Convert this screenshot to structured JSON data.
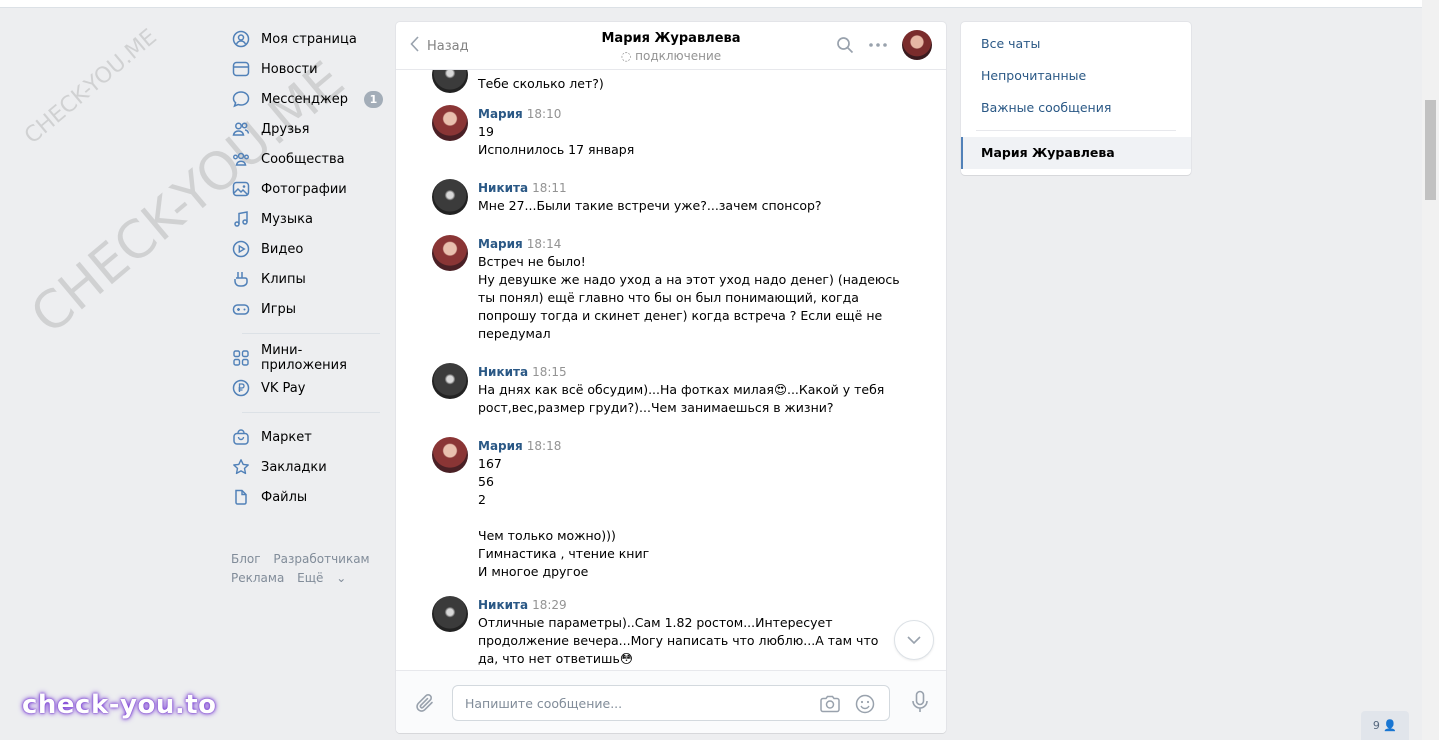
{
  "watermark": {
    "small": "CHECK-YOU.ME",
    "large": "CHECK-YOU.ME",
    "brand": "check-you.to"
  },
  "nav": {
    "items": [
      {
        "label": "Моя страница",
        "icon": "user-circle-icon"
      },
      {
        "label": "Новости",
        "icon": "news-icon"
      },
      {
        "label": "Мессенджер",
        "icon": "message-icon",
        "badge": "1"
      },
      {
        "label": "Друзья",
        "icon": "friends-icon"
      },
      {
        "label": "Сообщества",
        "icon": "communities-icon"
      },
      {
        "label": "Фотографии",
        "icon": "photo-icon"
      },
      {
        "label": "Музыка",
        "icon": "music-icon"
      },
      {
        "label": "Видео",
        "icon": "video-icon"
      },
      {
        "label": "Клипы",
        "icon": "clips-icon"
      },
      {
        "label": "Игры",
        "icon": "gamepad-icon"
      }
    ],
    "items2": [
      {
        "label": "Мини-приложения",
        "icon": "apps-icon"
      },
      {
        "label": "VK Pay",
        "icon": "vkpay-icon"
      }
    ],
    "items3": [
      {
        "label": "Маркет",
        "icon": "market-icon"
      },
      {
        "label": "Закладки",
        "icon": "star-icon"
      },
      {
        "label": "Файлы",
        "icon": "file-icon"
      }
    ],
    "footer": {
      "blog": "Блог",
      "dev": "Разработчикам",
      "ads": "Реклама",
      "more": "Ещё"
    }
  },
  "chat": {
    "back": "Назад",
    "title": "Мария Журавлева",
    "status": "подключение",
    "messages": [
      {
        "author": "",
        "time": "",
        "text": "Тебе сколько лет?)"
      },
      {
        "author": "Мария",
        "time": "18:10",
        "text": "19\nИсполнилось 17 января"
      },
      {
        "author": "Никита",
        "time": "18:11",
        "text": "Мне 27...Были такие встречи уже?...зачем спонсор?"
      },
      {
        "author": "Мария",
        "time": "18:14",
        "text": "Встреч не было!\nНу девушке же надо уход а на этот уход надо денег) (надеюсь\nты понял) ещё главно что бы он был понимающий, когда\nпопрошу тогда и скинет денег) когда встреча ? Если ещё не\nпередумал"
      },
      {
        "author": "Никита",
        "time": "18:15",
        "text": "На днях как всё обсудим)...На фотках милая😍...Какой у тебя\nрост,вес,размер груди?)...Чем занимаешься в жизни?"
      },
      {
        "author": "Мария",
        "time": "18:18",
        "text": "167\n56\n2\n\nЧем только можно)))\nГимнастика , чтение книг\nИ многое другое"
      },
      {
        "author": "Никита",
        "time": "18:29",
        "text": "Отличные параметры)..Сам 1.82 ростом...Интересует\nпродолжение вечера...Могу написать что люблю...А там что\nда, что нет ответишь😳"
      }
    ],
    "composer_placeholder": "Напишите сообщение..."
  },
  "right": {
    "items": [
      "Все чаты",
      "Непрочитанные",
      "Важные сообщения"
    ],
    "active": "Мария Журавлева"
  },
  "online_count": "9"
}
